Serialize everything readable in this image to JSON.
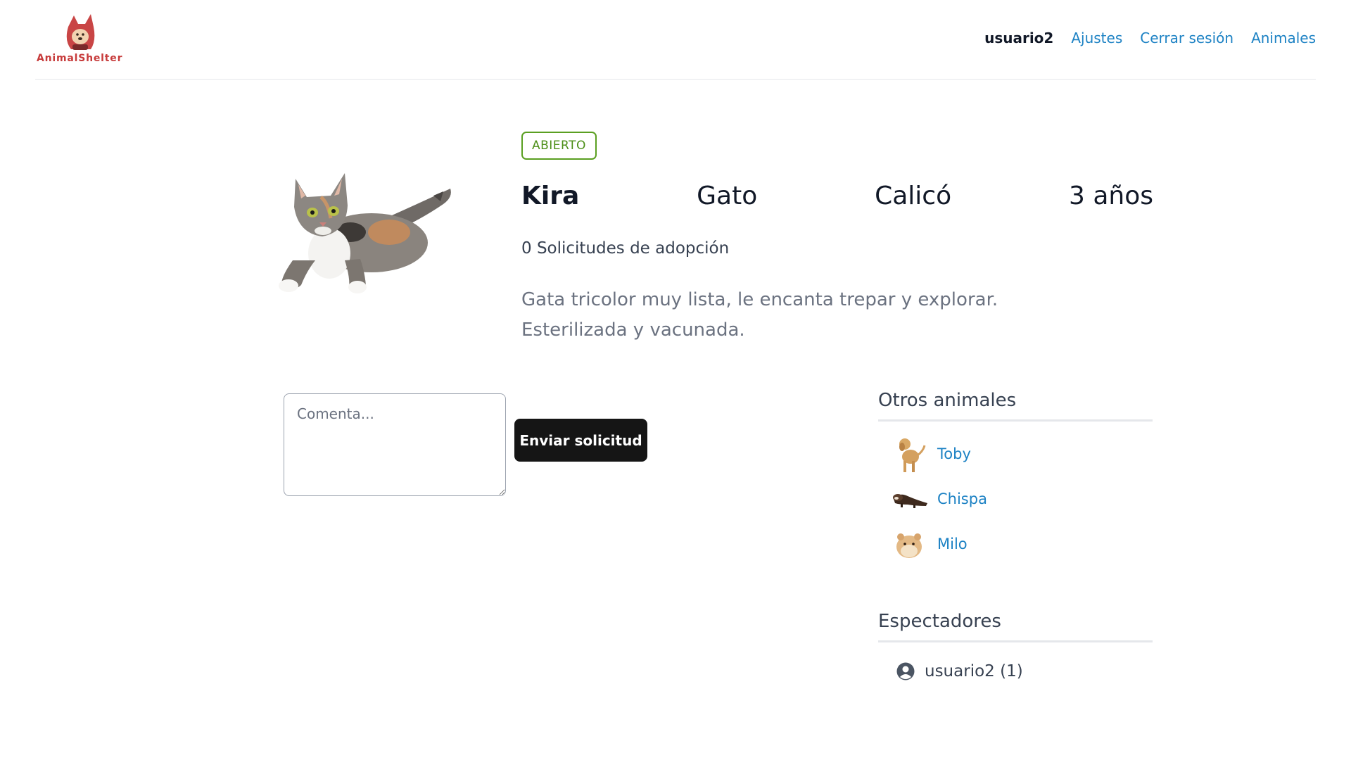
{
  "header": {
    "logo_text": "AnimalShelter",
    "username": "usuario2",
    "nav": [
      "Ajustes",
      "Cerrar sesión",
      "Animales"
    ]
  },
  "animal": {
    "status": "ABIERTO",
    "name": "Kira",
    "species": "Gato",
    "breed": "Calicó",
    "age": "3 años",
    "requests": "0 Solicitudes de adopción",
    "description": "Gata tricolor muy lista, le encanta trepar y explorar. Esterilizada y vacunada."
  },
  "form": {
    "comment_placeholder": "Comenta...",
    "submit_label": "Enviar solicitud"
  },
  "others": {
    "title": "Otros animales",
    "items": [
      {
        "name": "Toby"
      },
      {
        "name": "Chispa"
      },
      {
        "name": "Milo"
      }
    ]
  },
  "watchers": {
    "title": "Espectadores",
    "items": [
      {
        "label": "usuario2 (1)"
      }
    ]
  },
  "colors": {
    "link": "#1d82c4",
    "badge": "#5a9f21",
    "button": "#151515",
    "logo": "#c73b3b"
  }
}
